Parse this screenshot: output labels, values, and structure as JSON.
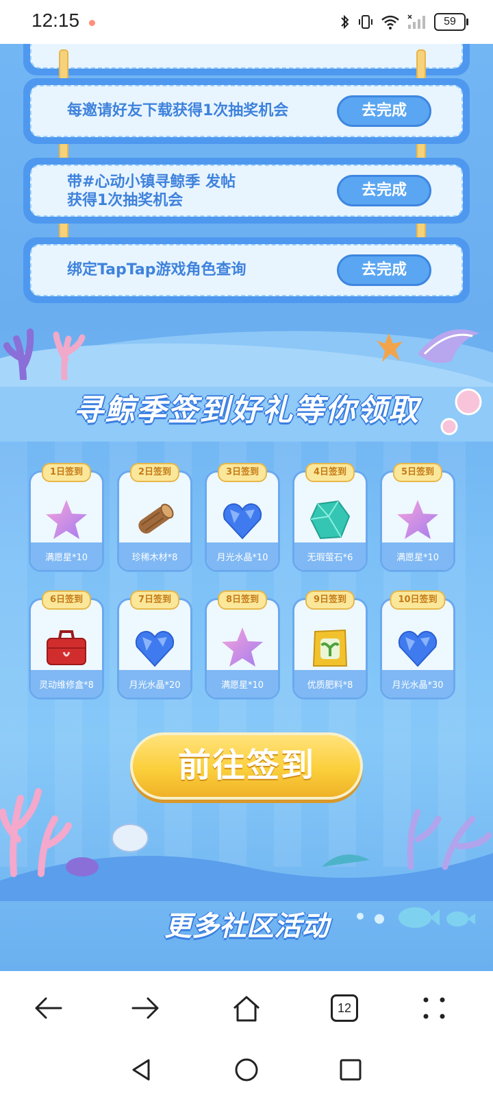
{
  "status_bar": {
    "time": "12:15",
    "battery": "59"
  },
  "tasks": [
    {
      "text_lines": [
        "每邀请好友下载获得1次抽奖机会"
      ],
      "button": "去完成"
    },
    {
      "text_lines": [
        "带#心动小镇寻鲸季 发帖",
        "获得1次抽奖机会"
      ],
      "button": "去完成"
    },
    {
      "text_lines": [
        "绑定TapTap游戏角色查询"
      ],
      "button": "去完成"
    }
  ],
  "sign_section": {
    "title": "寻鲸季签到好礼等你领取",
    "rewards": [
      {
        "day": "1日签到",
        "name": "满愿星*10",
        "icon": "star-icon"
      },
      {
        "day": "2日签到",
        "name": "珍稀木材*8",
        "icon": "wood-log-icon"
      },
      {
        "day": "3日签到",
        "name": "月光水晶*10",
        "icon": "crystal-heart-icon"
      },
      {
        "day": "4日签到",
        "name": "无瑕萤石*6",
        "icon": "gem-icon"
      },
      {
        "day": "5日签到",
        "name": "满愿星*10",
        "icon": "star-icon"
      },
      {
        "day": "6日签到",
        "name": "灵动维修盒*8",
        "icon": "toolbox-icon"
      },
      {
        "day": "7日签到",
        "name": "月光水晶*20",
        "icon": "crystal-heart-icon"
      },
      {
        "day": "8日签到",
        "name": "满愿星*10",
        "icon": "star-icon"
      },
      {
        "day": "9日签到",
        "name": "优质肥料*8",
        "icon": "fertilizer-bag-icon"
      },
      {
        "day": "10日签到",
        "name": "月光水晶*30",
        "icon": "crystal-heart-icon"
      }
    ],
    "go_button": "前往签到"
  },
  "more_section": {
    "title": "更多社区活动"
  },
  "browser_nav": {
    "tab_count": "12"
  }
}
